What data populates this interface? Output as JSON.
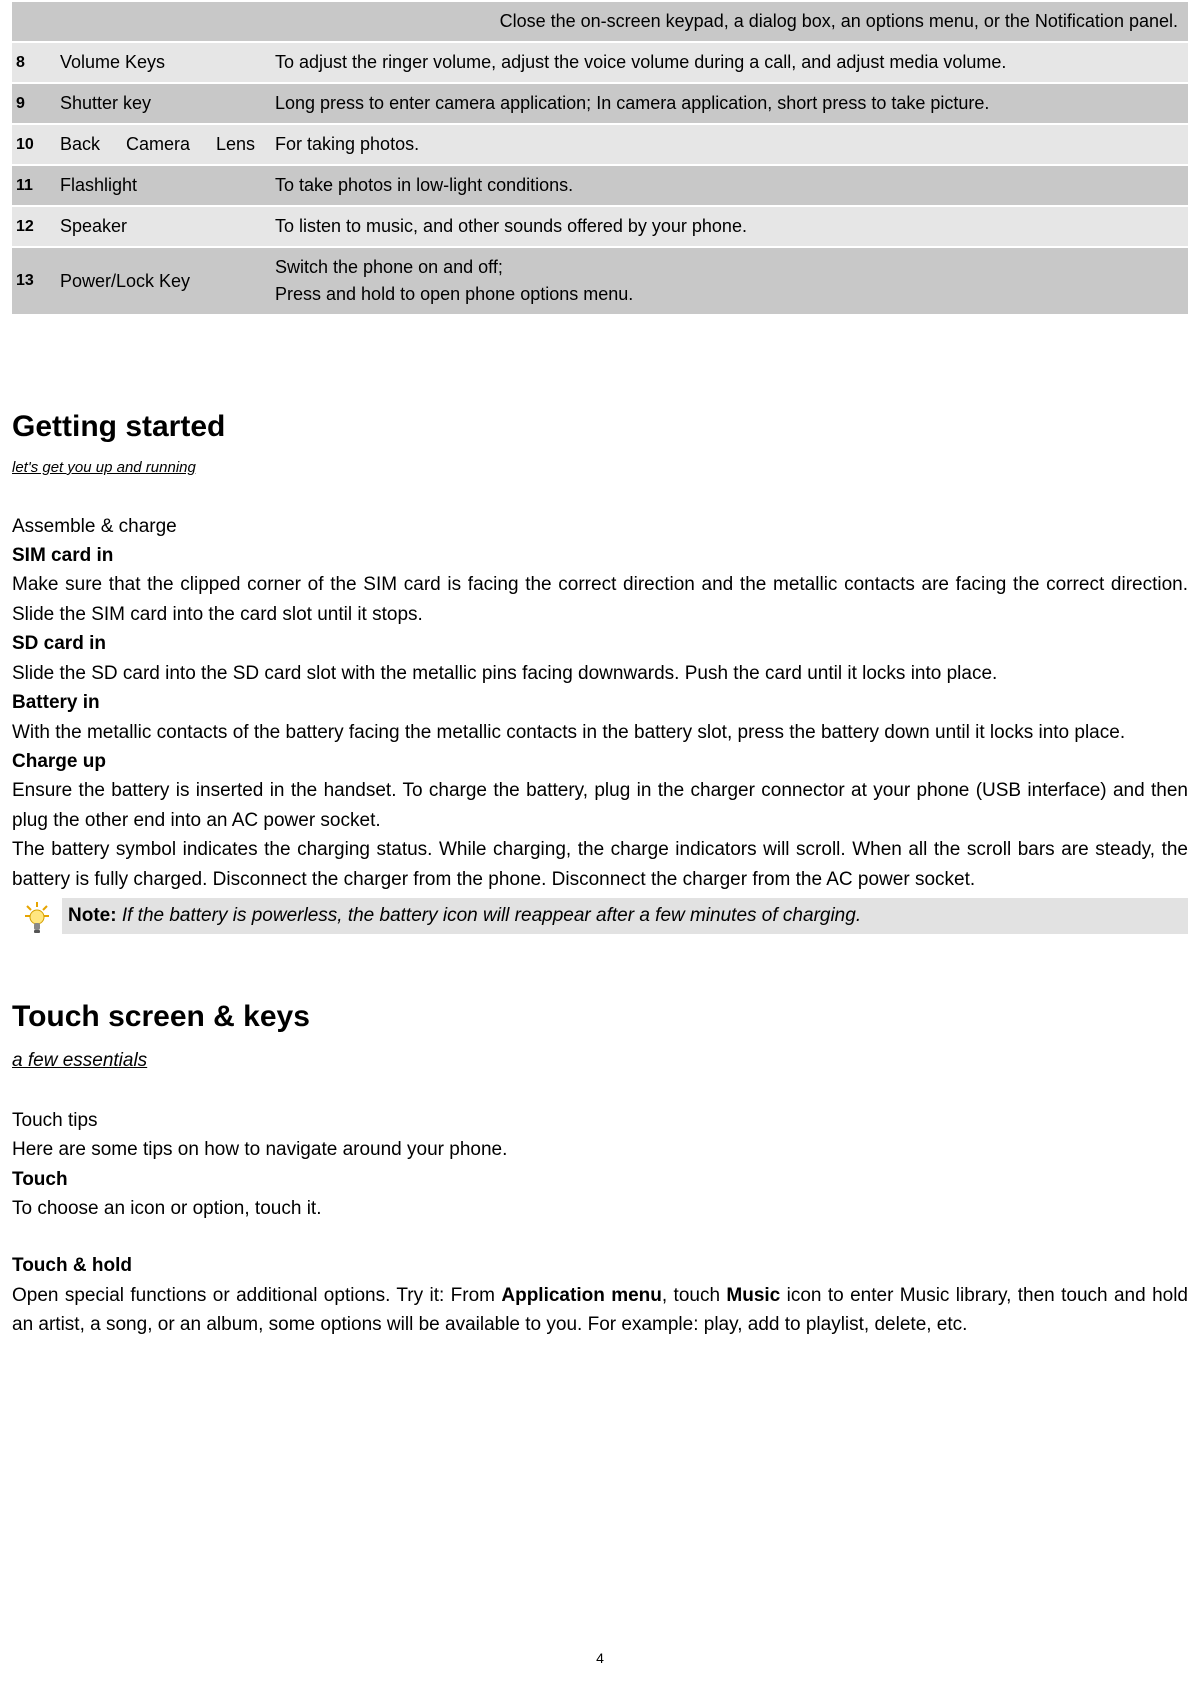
{
  "table": {
    "rows": [
      {
        "num": "",
        "name": "",
        "desc": "Close the on-screen keypad, a dialog box, an options menu, or the Notification panel.",
        "shade": "dark",
        "hideNumName": true
      },
      {
        "num": "8",
        "name": "Volume Keys",
        "desc": "To adjust the ringer volume, adjust the voice volume during a call, and adjust media volume.",
        "shade": "light"
      },
      {
        "num": "9",
        "name": "Shutter key",
        "desc": "Long press to enter camera application; In camera application, short press to take picture.",
        "shade": "dark"
      },
      {
        "num": "10",
        "name": "Back Camera Lens",
        "desc": "For taking photos.",
        "shade": "light",
        "nameJustify": true
      },
      {
        "num": "11",
        "name": "Flashlight",
        "desc": "To take photos in low-light conditions.",
        "shade": "dark"
      },
      {
        "num": "12",
        "name": "Speaker",
        "desc": "To listen to music, and other sounds offered by your phone.",
        "shade": "light"
      },
      {
        "num": "13",
        "name": "Power/Lock Key",
        "desc": "Switch the phone on and off;\nPress and hold to open phone options menu.",
        "shade": "dark"
      }
    ]
  },
  "getting_started": {
    "title": "Getting started",
    "subtitle": "let's get you up and running",
    "assemble_heading": "Assemble & charge",
    "sim_heading": "SIM card in",
    "sim_text": "Make sure that the clipped corner of the SIM card is facing the correct direction and the metallic contacts are facing the correct direction. Slide the SIM card into the card slot until it stops.",
    "sd_heading": "SD card in",
    "sd_text": "Slide the SD card into the SD card slot with the metallic pins facing downwards. Push the card until it locks into place.",
    "battery_heading": "Battery in",
    "battery_text": "With the metallic contacts of the battery facing the metallic contacts in the battery slot, press the battery down until it locks into place.",
    "charge_heading": "Charge up",
    "charge_text1": "Ensure the battery is inserted in the handset. To charge the battery, plug in the charger connector at your phone (USB interface) and then plug the other end into an AC power socket.",
    "charge_text2": "The battery symbol indicates the charging status. While charging, the charge indicators will scroll. When all the scroll bars are steady, the battery is fully charged. Disconnect the charger from the phone. Disconnect the charger from the AC power socket.",
    "note_label": "Note:",
    "note_text": " If the battery is powerless, the battery icon will reappear after a few minutes of charging."
  },
  "touch_screen": {
    "title": "Touch screen & keys",
    "subtitle": "a few essentials",
    "tips_heading": "Touch tips",
    "tips_text": "Here are some tips on how to navigate around your phone.",
    "touch_heading": "Touch",
    "touch_text": "To choose an icon or option, touch it.",
    "hold_heading": "Touch & hold",
    "hold_run1": "Open special functions or additional options. Try it: From ",
    "hold_bold1": "Application menu",
    "hold_run2": ", touch ",
    "hold_bold2": "Music",
    "hold_run3": " icon to enter Music library, then touch and hold an artist, a song, or an album, some options will be available to you. For example: play, add to playlist, delete, etc."
  },
  "page_number": "4"
}
